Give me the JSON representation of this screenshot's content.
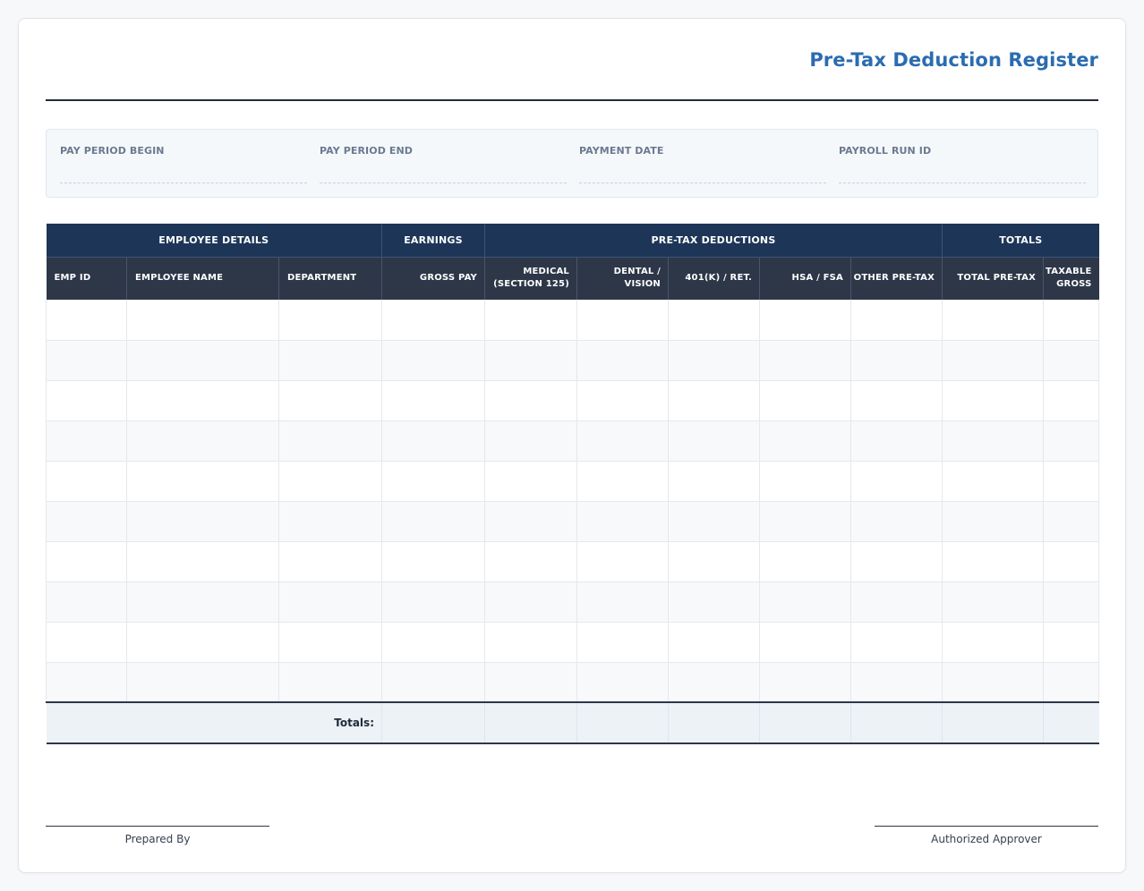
{
  "document": {
    "title": "Pre-Tax Deduction Register"
  },
  "meta_fields": [
    {
      "label": "PAY PERIOD BEGIN",
      "value": ""
    },
    {
      "label": "PAY PERIOD END",
      "value": ""
    },
    {
      "label": "PAYMENT DATE",
      "value": ""
    },
    {
      "label": "PAYROLL RUN ID",
      "value": ""
    }
  ],
  "table": {
    "groups": [
      {
        "label": "EMPLOYEE DETAILS"
      },
      {
        "label": "EARNINGS"
      },
      {
        "label": "PRE-TAX DEDUCTIONS"
      },
      {
        "label": "TOTALS"
      }
    ],
    "columns": [
      {
        "label": "EMP ID"
      },
      {
        "label": "EMPLOYEE NAME"
      },
      {
        "label": "DEPARTMENT"
      },
      {
        "label": "GROSS PAY"
      },
      {
        "line1": "MEDICAL",
        "line2": "(SECTION 125)"
      },
      {
        "line1": "DENTAL /",
        "line2": "VISION"
      },
      {
        "label": "401(K) / RET."
      },
      {
        "label": "HSA / FSA"
      },
      {
        "label": "OTHER PRE-TAX"
      },
      {
        "label": "TOTAL PRE-TAX"
      },
      {
        "line1": "TAXABLE",
        "line2": "GROSS"
      }
    ],
    "rows": [
      [
        "",
        "",
        "",
        "",
        "",
        "",
        "",
        "",
        "",
        "",
        ""
      ],
      [
        "",
        "",
        "",
        "",
        "",
        "",
        "",
        "",
        "",
        "",
        ""
      ],
      [
        "",
        "",
        "",
        "",
        "",
        "",
        "",
        "",
        "",
        "",
        ""
      ],
      [
        "",
        "",
        "",
        "",
        "",
        "",
        "",
        "",
        "",
        "",
        ""
      ],
      [
        "",
        "",
        "",
        "",
        "",
        "",
        "",
        "",
        "",
        "",
        ""
      ],
      [
        "",
        "",
        "",
        "",
        "",
        "",
        "",
        "",
        "",
        "",
        ""
      ],
      [
        "",
        "",
        "",
        "",
        "",
        "",
        "",
        "",
        "",
        "",
        ""
      ],
      [
        "",
        "",
        "",
        "",
        "",
        "",
        "",
        "",
        "",
        "",
        ""
      ],
      [
        "",
        "",
        "",
        "",
        "",
        "",
        "",
        "",
        "",
        "",
        ""
      ],
      [
        "",
        "",
        "",
        "",
        "",
        "",
        "",
        "",
        "",
        "",
        ""
      ]
    ],
    "totals_label": "Totals:"
  },
  "signatures": {
    "left": "Prepared By",
    "right": "Authorized Approver"
  },
  "colors": {
    "title": "#2b6cb0",
    "group_header": "#1d3557",
    "column_header": "#2d3748",
    "totals_bg": "#edf2f7"
  }
}
